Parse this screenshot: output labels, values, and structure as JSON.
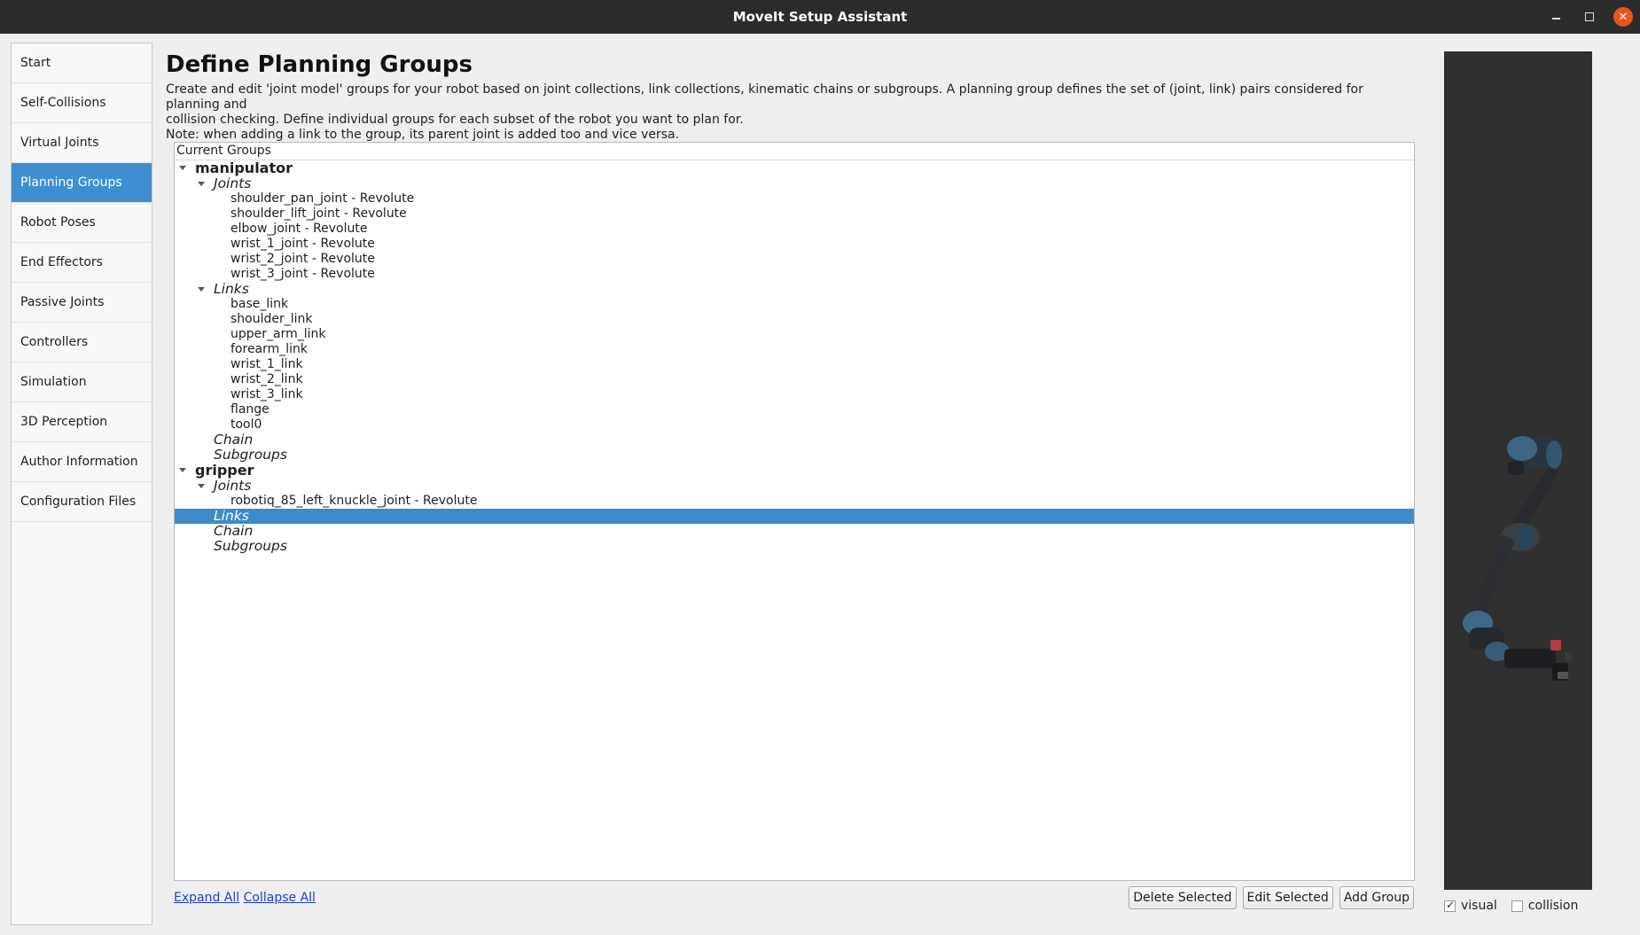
{
  "window": {
    "title": "MoveIt Setup Assistant"
  },
  "sidebar": {
    "items": [
      {
        "label": "Start",
        "active": false
      },
      {
        "label": "Self-Collisions",
        "active": false
      },
      {
        "label": "Virtual Joints",
        "active": false
      },
      {
        "label": "Planning Groups",
        "active": true
      },
      {
        "label": "Robot Poses",
        "active": false
      },
      {
        "label": "End Effectors",
        "active": false
      },
      {
        "label": "Passive Joints",
        "active": false
      },
      {
        "label": "Controllers",
        "active": false
      },
      {
        "label": "Simulation",
        "active": false
      },
      {
        "label": "3D Perception",
        "active": false
      },
      {
        "label": "Author Information",
        "active": false
      },
      {
        "label": "Configuration Files",
        "active": false
      }
    ]
  },
  "main": {
    "title": "Define Planning Groups",
    "description": [
      "Create and edit 'joint model' groups for your robot based on joint collections, link collections, kinematic chains or subgroups. A planning group defines the set of (joint, link) pairs considered for planning and",
      "collision checking. Define individual groups for each subset of the robot you want to plan for.",
      "Note: when adding a link to the group, its parent joint is added too and vice versa."
    ],
    "tree": {
      "header": "Current Groups",
      "groups": [
        {
          "name": "manipulator",
          "joints_label": "Joints",
          "joints": [
            "shoulder_pan_joint - Revolute",
            "shoulder_lift_joint - Revolute",
            "elbow_joint - Revolute",
            "wrist_1_joint - Revolute",
            "wrist_2_joint - Revolute",
            "wrist_3_joint - Revolute"
          ],
          "links_label": "Links",
          "links": [
            "base_link",
            "shoulder_link",
            "upper_arm_link",
            "forearm_link",
            "wrist_1_link",
            "wrist_2_link",
            "wrist_3_link",
            "flange",
            "tool0"
          ],
          "chain_label": "Chain",
          "subgroups_label": "Subgroups"
        },
        {
          "name": "gripper",
          "joints_label": "Joints",
          "joints": [
            "robotiq_85_left_knuckle_joint - Revolute"
          ],
          "links_label": "Links",
          "links_selected": true,
          "chain_label": "Chain",
          "subgroups_label": "Subgroups"
        }
      ]
    },
    "links": {
      "expand_all": "Expand All",
      "collapse_all": "Collapse All"
    },
    "buttons": {
      "delete": "Delete Selected",
      "edit": "Edit Selected",
      "add": "Add Group"
    }
  },
  "viewer": {
    "visual_label": "visual",
    "visual_checked": true,
    "collision_label": "collision",
    "collision_checked": false
  },
  "colors": {
    "selection": "#3a8ccb",
    "nav_active": "#3d8fd1",
    "viewer_bg": "#303030"
  }
}
